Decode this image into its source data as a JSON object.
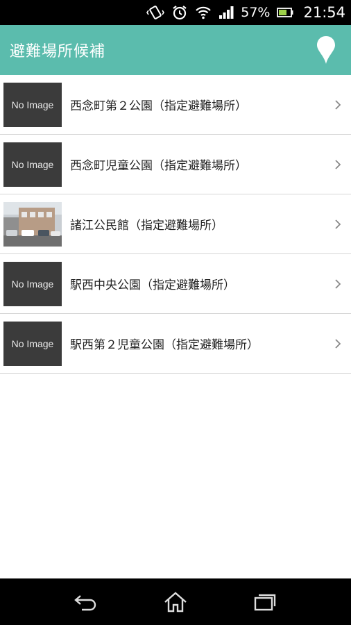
{
  "status_bar": {
    "battery_percent": "57%",
    "time": "21:54",
    "icons": [
      "vibrate-icon",
      "alarm-icon",
      "wifi-icon",
      "signal-icon",
      "battery-icon"
    ]
  },
  "app_bar": {
    "title": "避難場所候補",
    "color": "#5bbcad",
    "action_icon": "map-pin-icon"
  },
  "list": {
    "items": [
      {
        "thumbnail_text": "No Image",
        "label": "西念町第２公園（指定避難場所）"
      },
      {
        "thumbnail_text": "No Image",
        "label": "西念町児童公園（指定避難場所）"
      },
      {
        "thumbnail_text": "",
        "label": "諸江公民館（指定避難場所）"
      },
      {
        "thumbnail_text": "No Image",
        "label": "駅西中央公園（指定避難場所）"
      },
      {
        "thumbnail_text": "No Image",
        "label": "駅西第２児童公園（指定避難場所）"
      }
    ]
  },
  "nav_bar": {
    "buttons": [
      "back-icon",
      "home-icon",
      "recent-apps-icon"
    ]
  }
}
